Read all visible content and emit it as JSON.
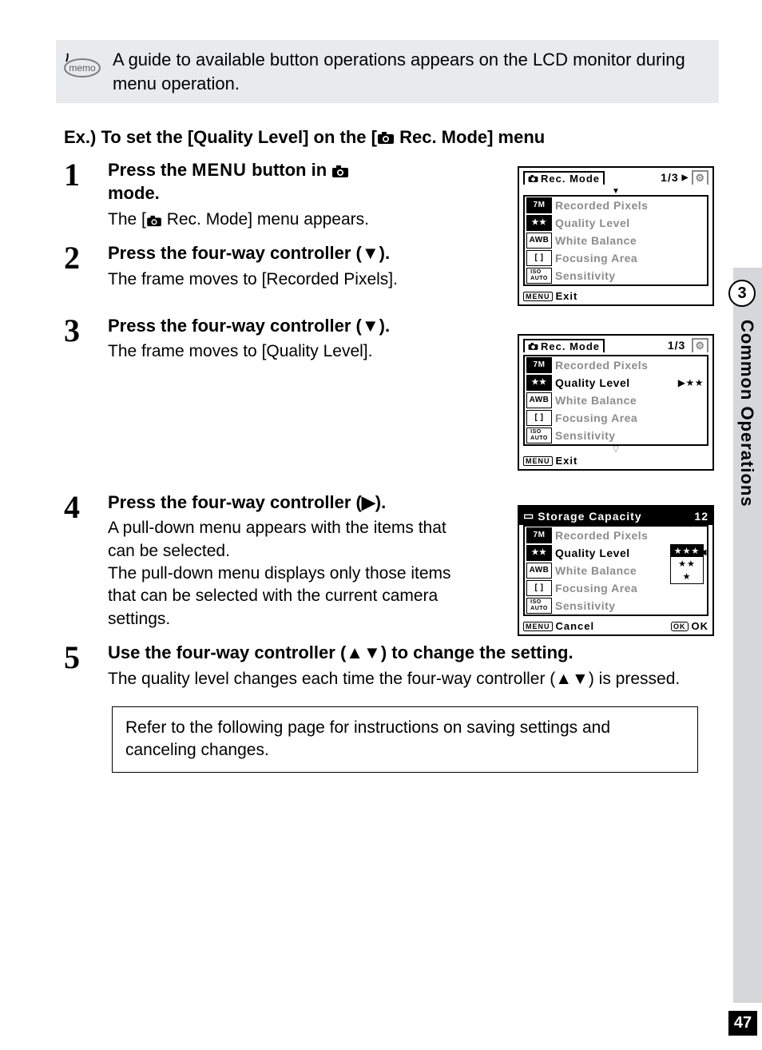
{
  "memo": {
    "icon_label": "memo",
    "text": "A guide to available button operations appears on the LCD monitor during menu operation."
  },
  "heading": {
    "prefix": "Ex.) To set the [Quality Level] on the [",
    "menu_name": " Rec. Mode] menu"
  },
  "steps": [
    {
      "num": "1",
      "title_parts": {
        "a": "Press the ",
        "menu_word": "MENU",
        "b": " button in ",
        "c": " mode."
      },
      "desc_parts": {
        "a": "The [",
        "b": " Rec. Mode] menu appears."
      }
    },
    {
      "num": "2",
      "title": "Press the four-way controller (▼).",
      "desc": "The frame moves to [Recorded Pixels]."
    },
    {
      "num": "3",
      "title": "Press the four-way controller (▼).",
      "desc": "The frame moves to [Quality Level]."
    },
    {
      "num": "4",
      "title": "Press the four-way controller (▶).",
      "desc": "A pull-down menu appears with the items that can be selected.\nThe pull-down menu displays only those items that can be selected with the current camera settings."
    },
    {
      "num": "5",
      "title": "Use the four-way controller (▲▼) to change the setting.",
      "desc": "The quality level changes each time the four-way controller (▲▼) is pressed."
    }
  ],
  "refbox": "Refer to the following page for instructions on saving settings and canceling changes.",
  "sidetab": {
    "chapter": "3",
    "title": "Common Operations",
    "page": "47"
  },
  "lcd_common": {
    "title": "Rec. Mode",
    "page": "1/3",
    "items": [
      {
        "icon": "7M",
        "dark": true,
        "label": "Recorded Pixels"
      },
      {
        "icon": "★★",
        "dark": true,
        "label": "Quality Level"
      },
      {
        "icon": "AWB",
        "dark": false,
        "label": "White Balance"
      },
      {
        "icon": "[ ]",
        "dark": false,
        "label": "Focusing Area"
      },
      {
        "icon": "ISO\nAUTO",
        "dark": false,
        "label": "Sensitivity"
      }
    ],
    "exit": "Exit",
    "menu": "MENU"
  },
  "lcd2_value": "▶★★",
  "lcd3": {
    "header": "Storage Capacity",
    "count": "12",
    "cancel": "Cancel",
    "ok": "OK",
    "options": [
      "★★★",
      "★★",
      "★"
    ]
  }
}
